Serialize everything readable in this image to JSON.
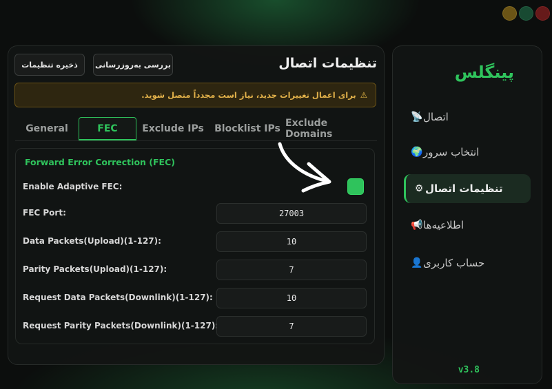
{
  "window_controls": [
    "minimize",
    "maximize",
    "close"
  ],
  "sidebar": {
    "brand": "پینگلس",
    "items": [
      {
        "label": "اتصال",
        "icon": "satellite-dish-icon",
        "active": false
      },
      {
        "label": "انتخاب سرور",
        "icon": "globe-icon",
        "active": false
      },
      {
        "label": "تنظیمات اتصال",
        "icon": "gear-icon",
        "active": true
      },
      {
        "label": "اطلاعیه‌ها",
        "icon": "megaphone-icon",
        "active": false
      },
      {
        "label": "حساب کاربری",
        "icon": "user-icon",
        "active": false
      }
    ],
    "version": "v3.8"
  },
  "main": {
    "title": "تنظیمات اتصال",
    "save_label": "ذخیره تنظیمات",
    "check_update_label": "بررسی به‌روزرسانی",
    "warning": "برای اعمال تغییرات جدید، نیاز است مجدداً متصل شوید.",
    "tabs": [
      {
        "label": "General",
        "active": false
      },
      {
        "label": "FEC",
        "active": true
      },
      {
        "label": "Exclude IPs",
        "active": false
      },
      {
        "label": "Blocklist IPs",
        "active": false
      },
      {
        "label": "Exclude Domains",
        "active": false
      }
    ],
    "section": {
      "title": "Forward Error Correction (FEC)",
      "adaptive_label": "Enable Adaptive FEC:",
      "adaptive_enabled": true,
      "fields": [
        {
          "label": "FEC Port:",
          "value": "27003"
        },
        {
          "label": "Data Packets(Upload)(1-127):",
          "value": "10"
        },
        {
          "label": "Parity Packets(Upload)(1-127):",
          "value": "7"
        },
        {
          "label": "Request Data Packets(Downlink)(1-127):",
          "value": "10"
        },
        {
          "label": "Request Parity Packets(Downlink)(1-127):",
          "value": "7"
        }
      ]
    }
  },
  "colors": {
    "accent": "#2fc35c",
    "warning_text": "#e2b14a",
    "background": "#0c0e0d"
  }
}
